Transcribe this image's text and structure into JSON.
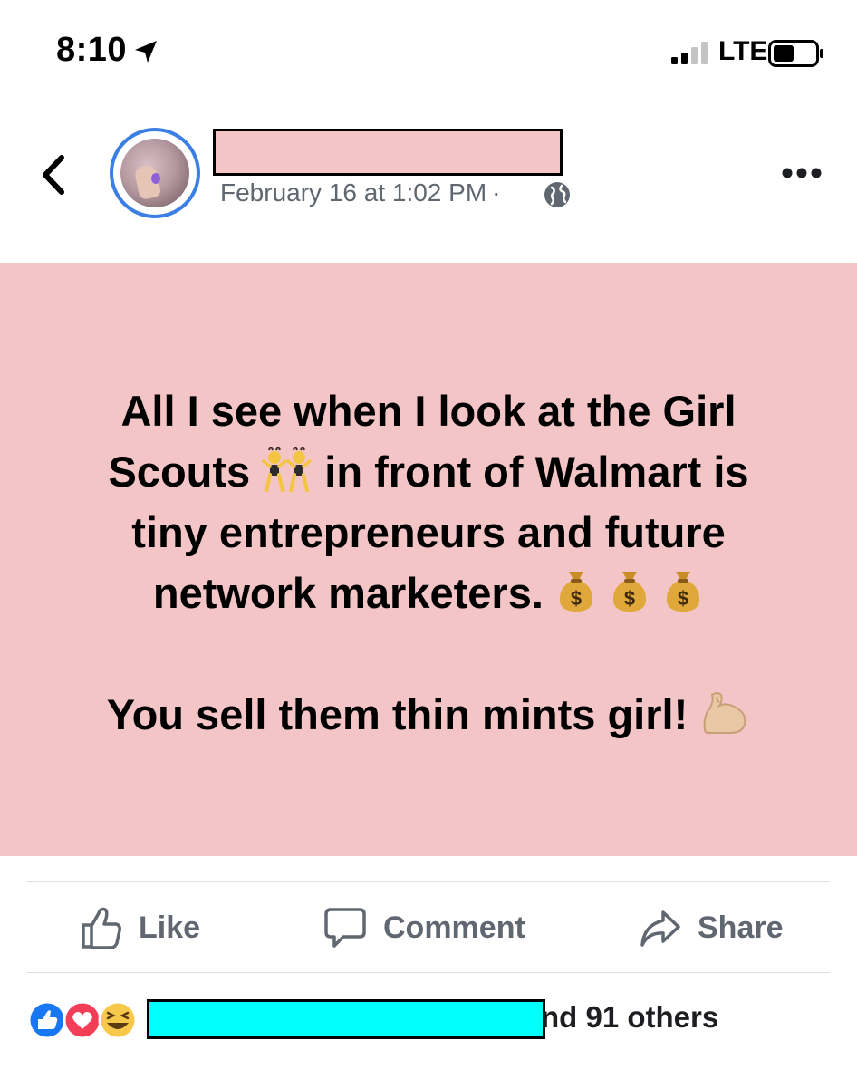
{
  "status_bar": {
    "time": "8:10",
    "network": "LTE",
    "icons": [
      "location-arrow-icon",
      "signal-icon",
      "battery-icon"
    ]
  },
  "post": {
    "author_name": "",
    "timestamp": "February 16 at 1:02 PM",
    "separator": "·",
    "privacy_icon": "globe-icon",
    "background_color": "#f4c5c6",
    "text_lines": [
      "All I see when I look at the Girl",
      "Scouts",
      "in front of Walmart is",
      "tiny entrepreneurs and future",
      "network marketers.",
      "You sell them thin mints girl!"
    ],
    "emojis": [
      "dancers-emoji",
      "money-bag-emoji",
      "money-bag-emoji",
      "money-bag-emoji",
      "flexed-biceps-emoji"
    ]
  },
  "actions": {
    "like": "Like",
    "comment": "Comment",
    "share": "Share"
  },
  "reactions": {
    "icons": [
      "like-reaction-icon",
      "love-reaction-icon",
      "haha-reaction-icon"
    ],
    "summary_suffix": "nd 91 others"
  },
  "colors": {
    "accent": "#3b7fe4",
    "text_secondary": "#606770",
    "redaction_name": "#f4c5c6",
    "redaction_reactors": "#00ffff"
  }
}
